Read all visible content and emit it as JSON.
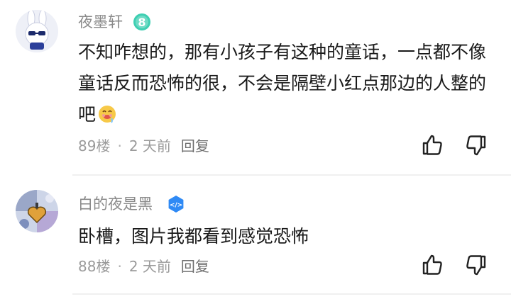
{
  "comments": [
    {
      "username": "夜墨轩",
      "level_badge": "8",
      "text": "不知咋想的，那有小孩子有这种的童话，一点都不像童话反而恐怖的很，不会是隔壁小红点那边的人整的吧",
      "emoji_icon": "drooling-face-emoji",
      "floor": "89楼",
      "time": "2 天前",
      "reply_label": "回复"
    },
    {
      "username": "白的夜是黑",
      "level_badge": "</>",
      "text": "卧槽，图片我都看到感觉恐怖",
      "floor": "88楼",
      "time": "2 天前",
      "reply_label": "回复"
    }
  ],
  "colors": {
    "username": "#8a8a8a",
    "text": "#1a1a1a",
    "meta": "#9a9a9a",
    "level8_badge": "#3ecfb2",
    "dev_badge": "#2f8af5"
  }
}
